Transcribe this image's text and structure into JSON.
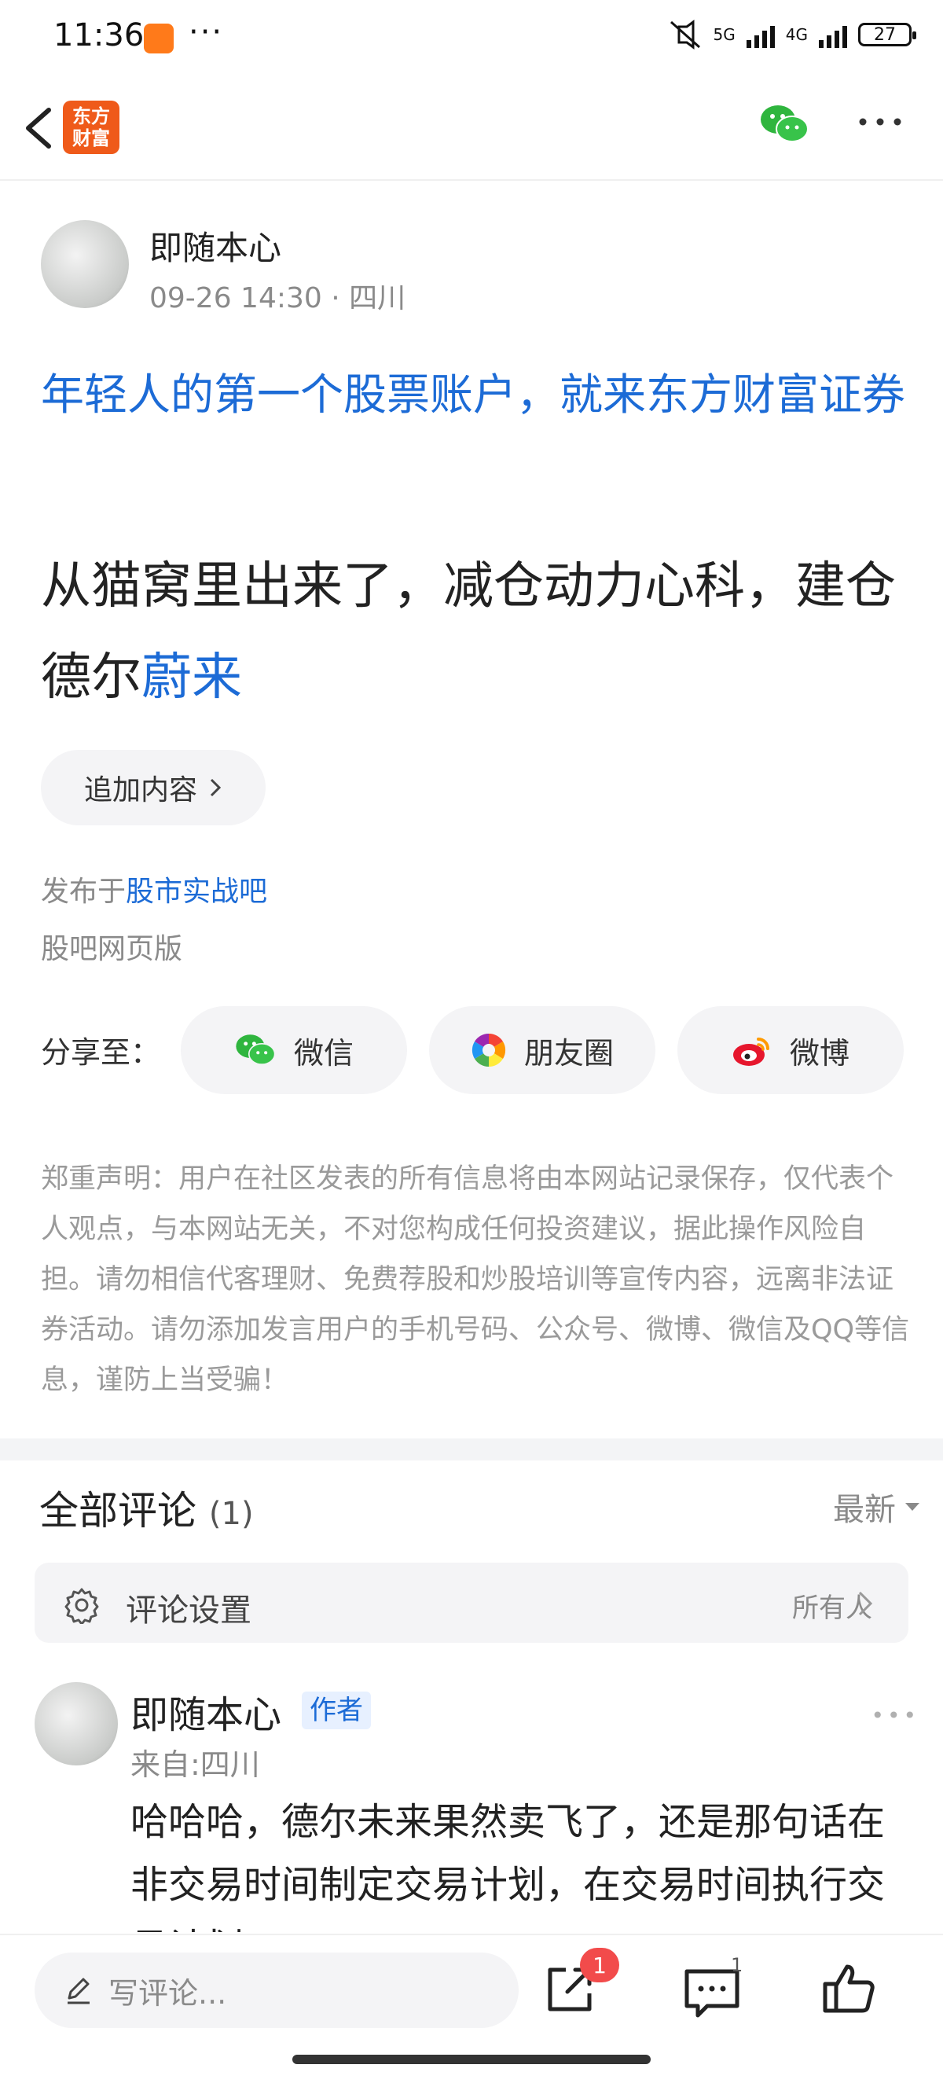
{
  "status_bar": {
    "time": "11:36",
    "dots": "···",
    "net1": "5G",
    "net2": "4G",
    "battery": "27"
  },
  "nav": {
    "logo_line1": "东方",
    "logo_line2": "财富"
  },
  "post": {
    "author": "即随本心",
    "meta": "09-26 14:30 · 四川",
    "ad_title": "年轻人的第一个股票账户，就来东方财富证券",
    "body_text": "从猫窝里出来了，减仓动力心科，建仓德尔",
    "body_link": "蔚来",
    "append_label": "追加内容",
    "published_prefix": "发布于",
    "published_bar": "股市实战吧",
    "web_version": "股吧网页版"
  },
  "share": {
    "label": "分享至：",
    "wechat": "微信",
    "moments": "朋友圈",
    "weibo": "微博"
  },
  "disclaimer": "郑重声明：用户在社区发表的所有信息将由本网站记录保存，仅代表个人观点，与本网站无关，不对您构成任何投资建议，据此操作风险自担。请勿相信代客理财、免费荐股和炒股培训等宣传内容，远离非法证券活动。请勿添加发言用户的手机号码、公众号、微博、微信及QQ等信息，谨防上当受骗！",
  "comments": {
    "title": "全部评论",
    "count": "(1)",
    "sort": "最新",
    "settings_label": "评论设置",
    "settings_value": "所有人",
    "items": [
      {
        "name": "即随本心",
        "badge": "作者",
        "location": "来自:四川",
        "text": "哈哈哈，德尔未来果然卖飞了，还是那句话在非交易时间制定交易计划，在交易时间执行交易计划"
      }
    ]
  },
  "bottom": {
    "placeholder": "写评论...",
    "share_badge": "1",
    "comment_count": "1"
  },
  "colors": {
    "accent_blue": "#1c6bd6",
    "brand_orange": "#ef5a1a",
    "badge_red": "#f24b4b"
  }
}
